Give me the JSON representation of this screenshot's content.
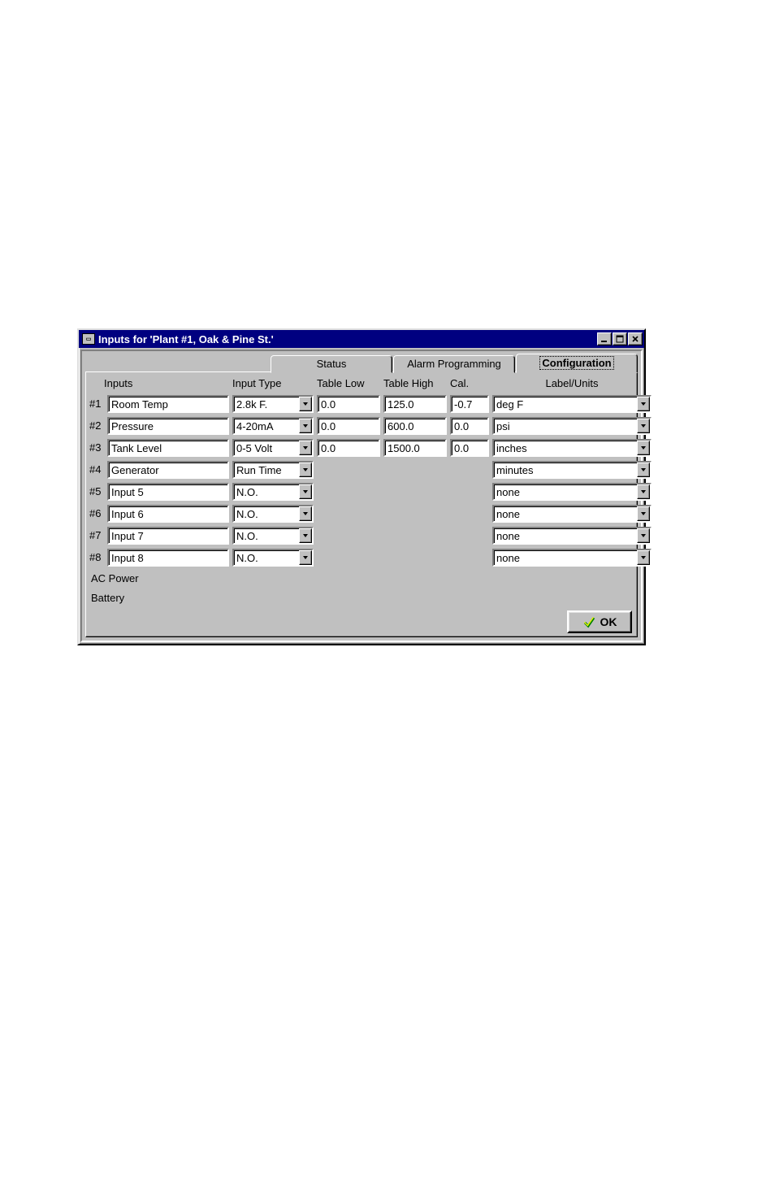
{
  "window": {
    "title": "Inputs for 'Plant #1, Oak & Pine St.'"
  },
  "tabs": {
    "status": "Status",
    "alarm": "Alarm Programming",
    "config": "Configuration"
  },
  "headers": {
    "inputs": "Inputs",
    "input_type": "Input Type",
    "table_low": "Table Low",
    "table_high": "Table High",
    "cal": "Cal.",
    "label_units": "Label/Units"
  },
  "rows": [
    {
      "num": "#1",
      "name": "Room Temp",
      "type": "2.8k F.",
      "low": "0.0",
      "high": "125.0",
      "cal": "-0.7",
      "units": "deg F",
      "analog": true
    },
    {
      "num": "#2",
      "name": "Pressure",
      "type": "4-20mA",
      "low": "0.0",
      "high": "600.0",
      "cal": "0.0",
      "units": "psi",
      "analog": true
    },
    {
      "num": "#3",
      "name": "Tank Level",
      "type": "0-5 Volt",
      "low": "0.0",
      "high": "1500.0",
      "cal": "0.0",
      "units": "inches",
      "analog": true
    },
    {
      "num": "#4",
      "name": "Generator",
      "type": "Run Time",
      "units": "minutes",
      "analog": false
    },
    {
      "num": "#5",
      "name": "Input 5",
      "type": "N.O.",
      "units": "none",
      "analog": false
    },
    {
      "num": "#6",
      "name": "Input 6",
      "type": "N.O.",
      "units": "none",
      "analog": false
    },
    {
      "num": "#7",
      "name": "Input 7",
      "type": "N.O.",
      "units": "none",
      "analog": false
    },
    {
      "num": "#8",
      "name": "Input 8",
      "type": "N.O.",
      "units": "none",
      "analog": false
    }
  ],
  "extras": {
    "ac": "AC Power",
    "batt": "Battery"
  },
  "buttons": {
    "ok": "OK"
  }
}
